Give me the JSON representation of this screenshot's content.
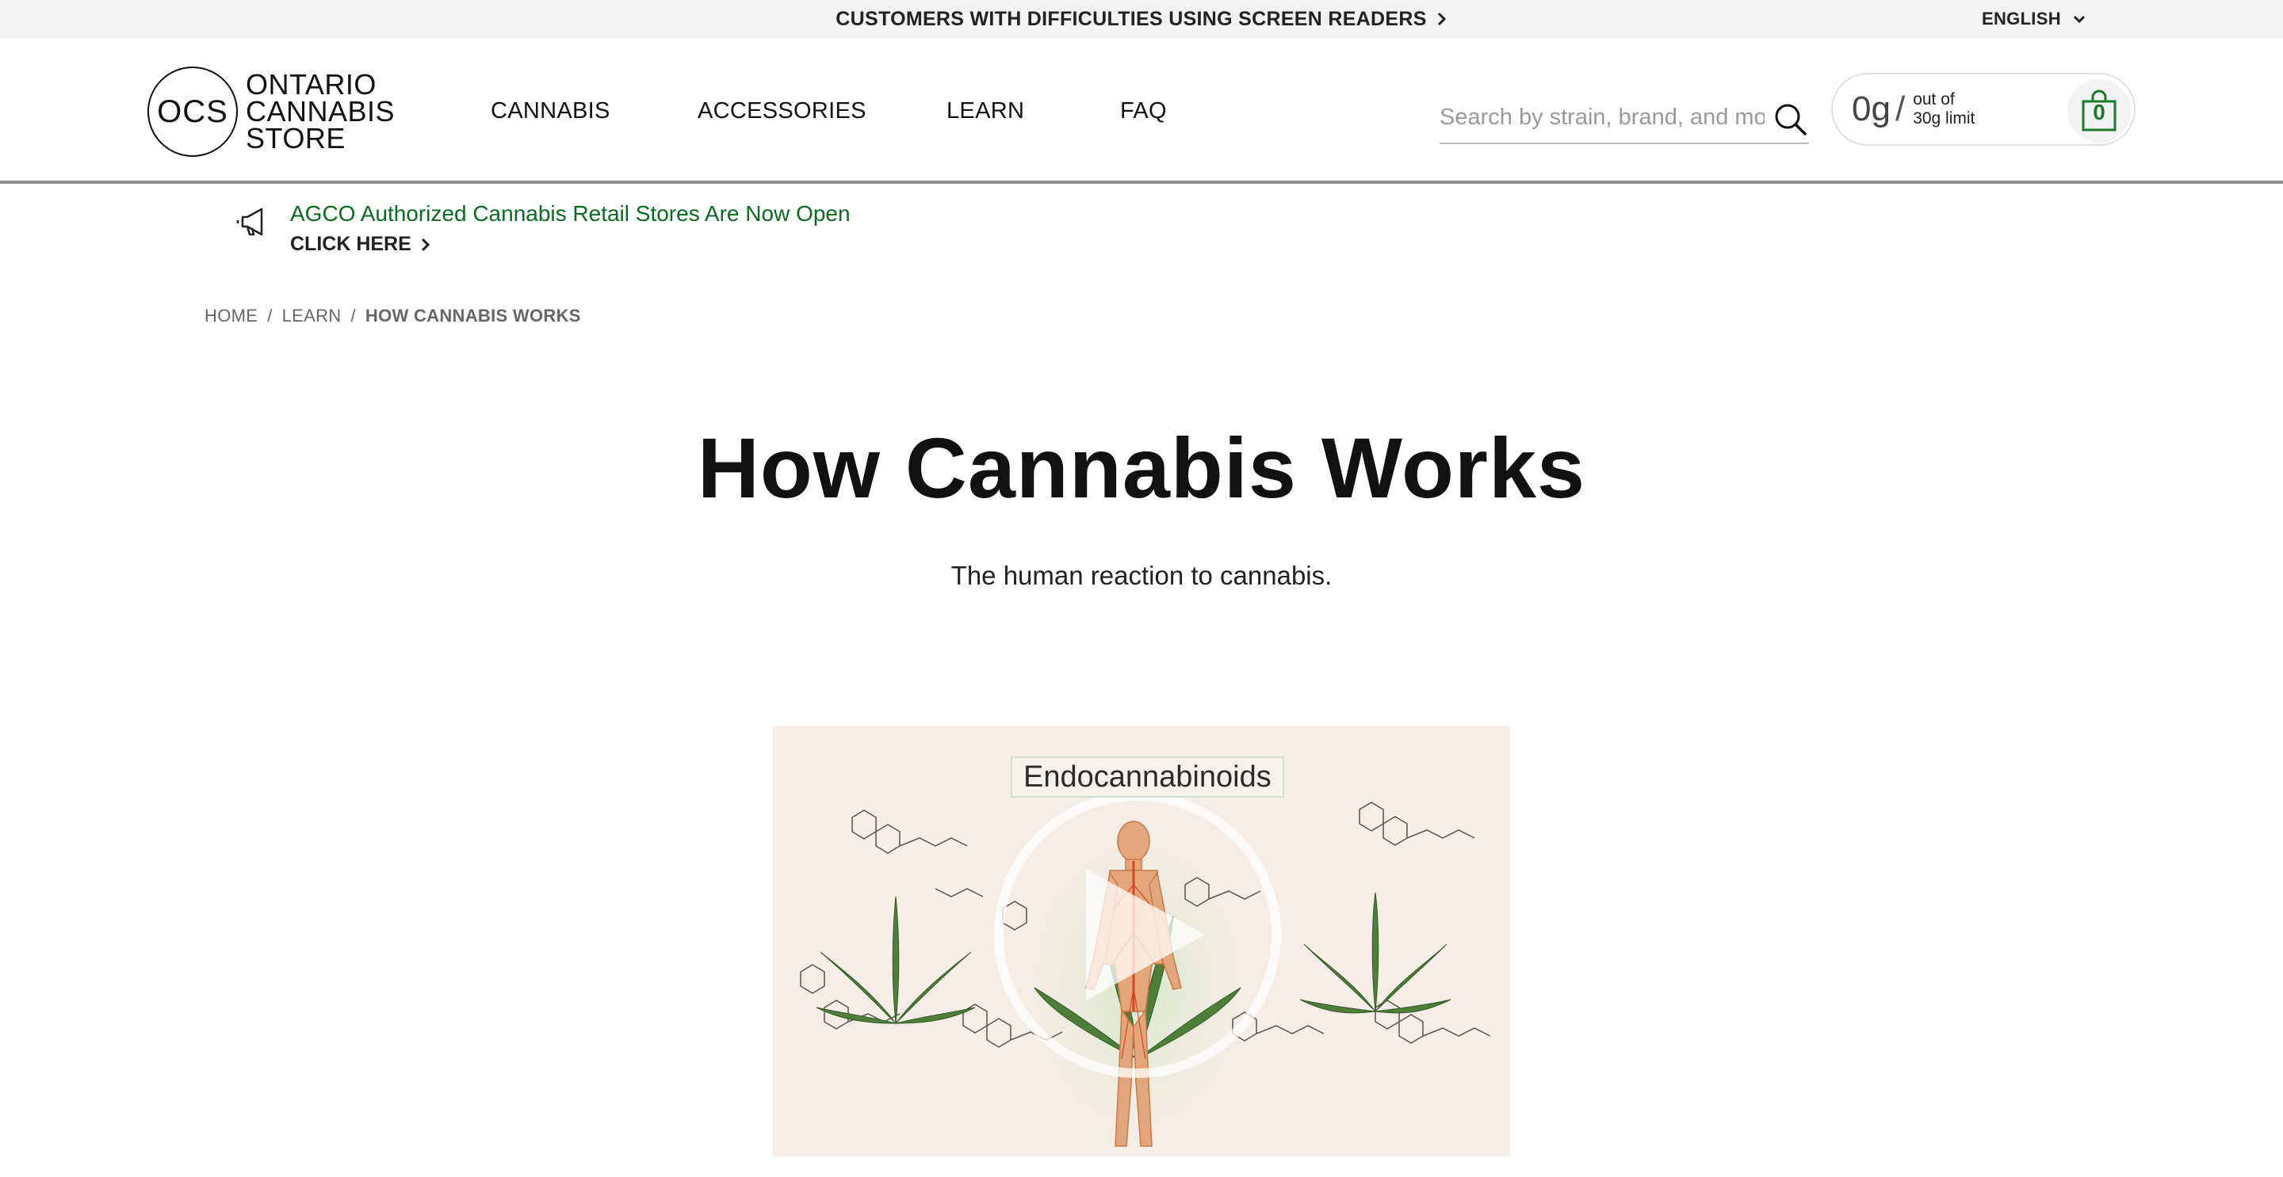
{
  "topbar": {
    "accessibility_link": "CUSTOMERS WITH DIFFICULTIES USING SCREEN READERS",
    "language": "ENGLISH"
  },
  "header": {
    "logo": {
      "monogram": "OCS",
      "line1": "ONTARIO",
      "line2": "CANNABIS",
      "line3": "STORE"
    },
    "nav": [
      {
        "label": "CANNABIS"
      },
      {
        "label": "ACCESSORIES"
      },
      {
        "label": "LEARN"
      },
      {
        "label": "FAQ"
      }
    ],
    "search": {
      "placeholder": "Search by strain, brand, and more",
      "value": ""
    },
    "cart": {
      "amount": "0g",
      "separator": "/",
      "limit_line1": "out of",
      "limit_line2": "30g limit",
      "item_count": "0"
    }
  },
  "announcement": {
    "message": "AGCO Authorized Cannabis Retail Stores Are Now Open",
    "cta": "CLICK HERE"
  },
  "breadcrumb": [
    {
      "label": "HOME"
    },
    {
      "label": "LEARN"
    },
    {
      "label": "HOW CANNABIS WORKS"
    }
  ],
  "page": {
    "title": "How Cannabis Works",
    "subtitle": "The human reaction to cannabis."
  },
  "video": {
    "caption": "Endocannabinoids"
  },
  "colors": {
    "accent_green": "#0a6b1f",
    "topbar_bg": "#f2f2f2",
    "video_bg": "#f5ede6"
  },
  "icons": [
    "chevron-right-icon",
    "chevron-down-icon",
    "search-icon",
    "shopping-bag-icon",
    "megaphone-icon",
    "play-icon"
  ]
}
